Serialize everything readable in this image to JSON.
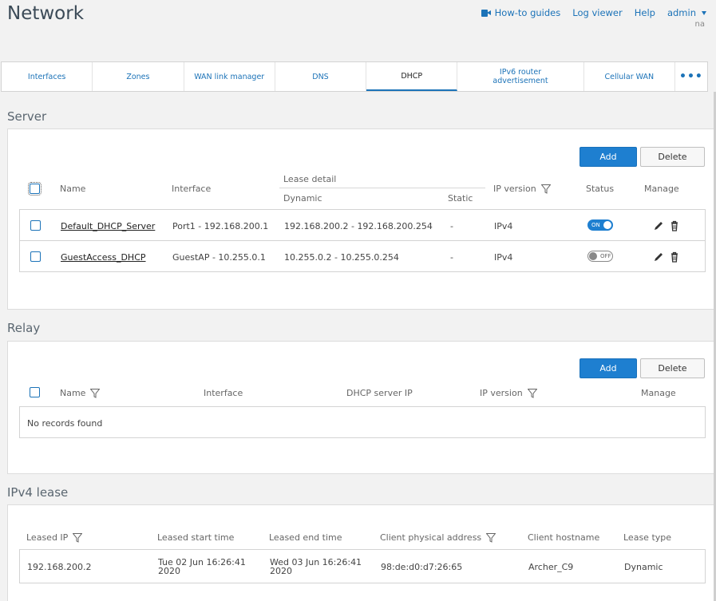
{
  "header": {
    "title": "Network",
    "nav": {
      "howto": "How-to guides",
      "logviewer": "Log viewer",
      "help": "Help",
      "user": "admin",
      "user_sub": "na"
    }
  },
  "tabs": [
    "Interfaces",
    "Zones",
    "WAN link manager",
    "DNS",
    "DHCP",
    "IPv6 router advertisement",
    "Cellular WAN",
    "•••"
  ],
  "active_tab": "DHCP",
  "server": {
    "title": "Server",
    "add": "Add",
    "delete": "Delete",
    "headers": {
      "name": "Name",
      "interface": "Interface",
      "lease_detail": "Lease detail",
      "dynamic": "Dynamic",
      "static": "Static",
      "ip_version": "IP version",
      "status": "Status",
      "manage": "Manage"
    },
    "rows": [
      {
        "name": "Default_DHCP_Server",
        "interface": "Port1 - 192.168.200.1",
        "dynamic": "192.168.200.2 - 192.168.200.254",
        "static": "-",
        "ip_version": "IPv4",
        "status": "ON"
      },
      {
        "name": "GuestAccess_DHCP",
        "interface": "GuestAP - 10.255.0.1",
        "dynamic": "10.255.0.2 - 10.255.0.254",
        "static": "-",
        "ip_version": "IPv4",
        "status": "OFF"
      }
    ]
  },
  "relay": {
    "title": "Relay",
    "add": "Add",
    "delete": "Delete",
    "headers": {
      "name": "Name",
      "interface": "Interface",
      "dhcp_server_ip": "DHCP server IP",
      "ip_version": "IP version",
      "manage": "Manage"
    },
    "empty": "No records found"
  },
  "lease": {
    "title": "IPv4 lease",
    "headers": {
      "leased_ip": "Leased IP",
      "start": "Leased start time",
      "end": "Leased end time",
      "mac": "Client physical address",
      "hostname": "Client hostname",
      "type": "Lease type"
    },
    "rows": [
      {
        "ip": "192.168.200.2",
        "start": "Tue 02 Jun 16:26:41 2020",
        "end": "Wed 03 Jun 16:26:41 2020",
        "mac": "98:de:d0:d7:26:65",
        "hostname": "Archer_C9",
        "type": "Dynamic"
      }
    ]
  },
  "colors": {
    "accent": "#1e7fd0",
    "link": "#1c73b8"
  }
}
